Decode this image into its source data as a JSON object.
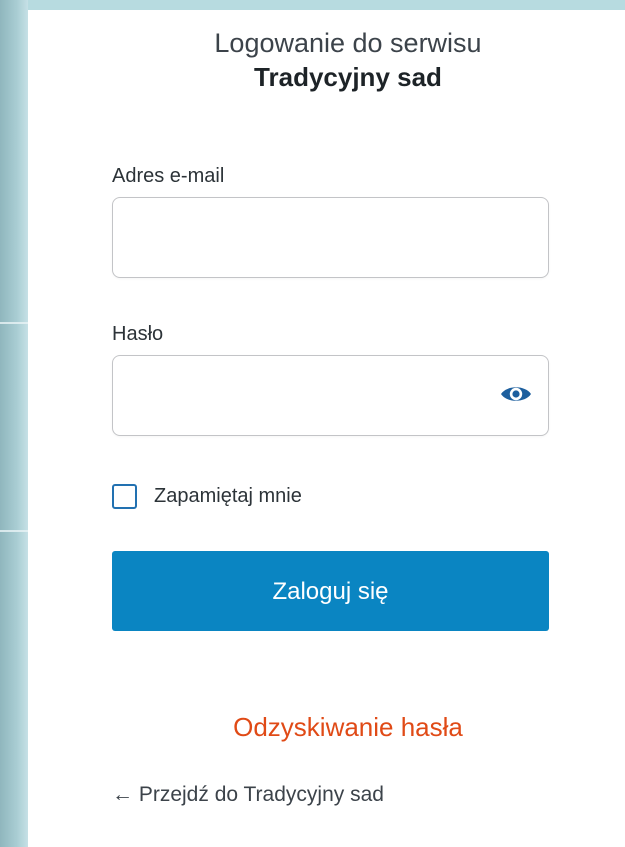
{
  "header": {
    "title_line1": "Logowanie do serwisu",
    "site_name": "Tradycyjny sad"
  },
  "form": {
    "email_label": "Adres e-mail",
    "email_value": "",
    "password_label": "Hasło",
    "password_value": "",
    "remember_label": "Zapamiętaj mnie",
    "remember_checked": false,
    "submit_label": "Zaloguj się"
  },
  "links": {
    "lost_password": "Odzyskiwanie hasła",
    "back_to_site": "← Przejdź do Tradycyjny sad"
  },
  "colors": {
    "primary_button": "#0a85c2",
    "lost_password_link": "#e04a16",
    "background": "#b9dbe1",
    "checkbox_border": "#2271b1"
  },
  "icons": {
    "show_password": "eye-icon"
  }
}
